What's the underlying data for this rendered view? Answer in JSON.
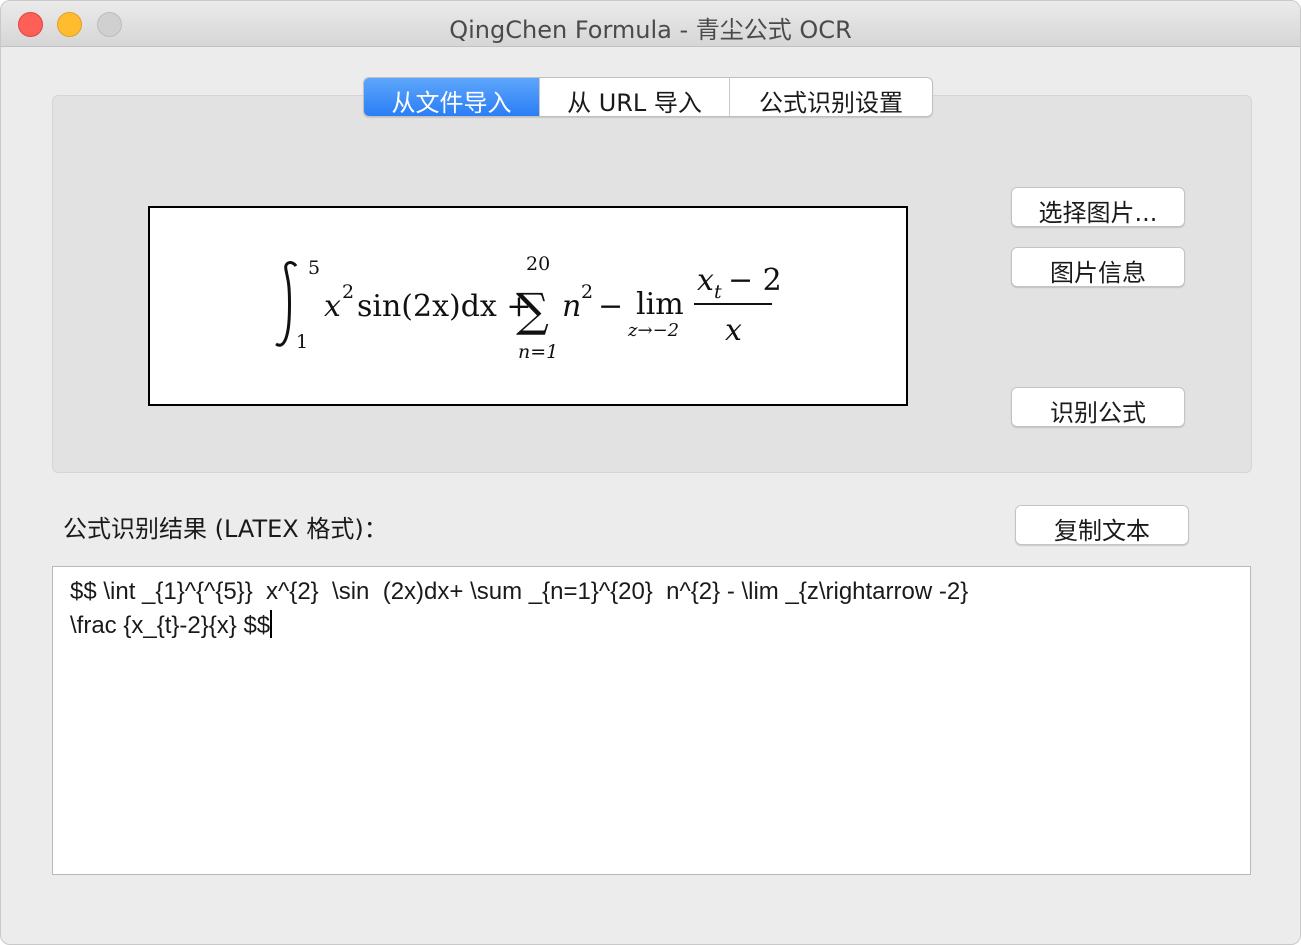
{
  "window": {
    "title": "QingChen Formula - 青尘公式 OCR"
  },
  "tabs": [
    {
      "label": "从文件导入",
      "active": true
    },
    {
      "label": "从 URL 导入",
      "active": false
    },
    {
      "label": "公式识别设置",
      "active": false
    }
  ],
  "buttons": {
    "select_image": "选择图片...",
    "image_info": "图片信息",
    "recognize": "识别公式",
    "copy_text": "复制文本"
  },
  "preview": {
    "formula_glyphs": {
      "integral_upper": "5",
      "integral_lower": "1",
      "integrand": "x",
      "integrand_exp": "2",
      "sin_part": "sin(2x)dx +",
      "sum_upper": "20",
      "sum_lower": "n=1",
      "sum_body": "n",
      "sum_exp": "2",
      "minus": "−",
      "lim": "lim",
      "lim_sub": "z→−2",
      "frac_num": "x",
      "frac_num_sub": "t",
      "frac_num_rest": "− 2",
      "frac_den": "x"
    }
  },
  "result": {
    "label": "公式识别结果 (LATEX 格式)：",
    "lines": [
      "$$ \\int _{1}^{^{5}}  x^{2}  \\sin  (2x)dx+ \\sum _{n=1}^{20}  n^{2} - \\lim _{z\\rightarrow -2}",
      "\\frac {x_{t}-2}{x} $$"
    ]
  },
  "colors": {
    "tab_active_bg": "#2a7ef5",
    "close": "#fe5f57",
    "minimize": "#febc2e",
    "zoom_disabled": "#d0d0d0"
  }
}
